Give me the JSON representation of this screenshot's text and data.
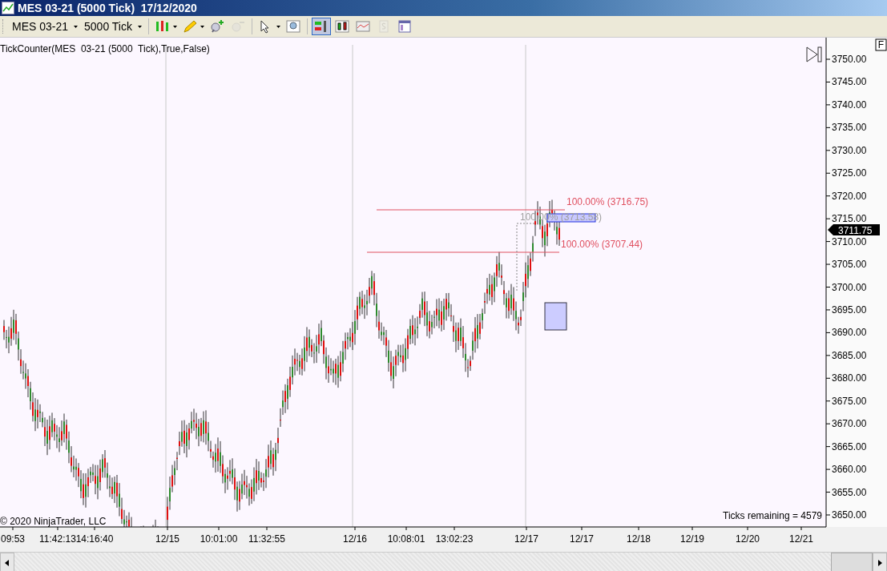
{
  "window": {
    "title": "MES 03-21 (5000 Tick)  17/12/2020"
  },
  "toolbar": {
    "instrument": "MES 03-21",
    "period": "5000 Tick",
    "tools": [
      {
        "kind": "bars",
        "dropdown": true,
        "selected": false,
        "disabled": false
      },
      {
        "kind": "pencil",
        "dropdown": true,
        "selected": false,
        "disabled": false
      },
      {
        "kind": "zoomin",
        "dropdown": false,
        "selected": false,
        "disabled": false
      },
      {
        "kind": "zoomout",
        "dropdown": false,
        "selected": false,
        "disabled": true
      },
      {
        "kind": "pointer",
        "dropdown": true,
        "selected": false,
        "disabled": false
      },
      {
        "kind": "magnifier",
        "dropdown": false,
        "selected": false,
        "disabled": false
      },
      {
        "kind": "databox",
        "dropdown": false,
        "selected": true,
        "disabled": false
      },
      {
        "kind": "candles",
        "dropdown": false,
        "selected": false,
        "disabled": false
      },
      {
        "kind": "lines",
        "dropdown": false,
        "selected": false,
        "disabled": false
      },
      {
        "kind": "dollar",
        "dropdown": false,
        "selected": false,
        "disabled": true
      },
      {
        "kind": "properties",
        "dropdown": false,
        "selected": false,
        "disabled": false
      }
    ]
  },
  "chart": {
    "indicator_label": "TickCounter(MES  03-21 (5000  Tick),True,False)",
    "axis_button": "F",
    "price_labels": [
      "3750.00",
      "3745.00",
      "3740.00",
      "3735.00",
      "3730.00",
      "3725.00",
      "3720.00",
      "3715.00",
      "3710.00",
      "3705.00",
      "3700.00",
      "3695.00",
      "3690.00",
      "3685.00",
      "3680.00",
      "3675.00",
      "3670.00",
      "3665.00",
      "3660.00",
      "3655.00",
      "3650.00"
    ],
    "current_price": "3711.75",
    "levels": [
      {
        "label": "100.00% (3716.75)",
        "kind": "upper"
      },
      {
        "label": "100.00% (3713.58)",
        "kind": "middle"
      },
      {
        "label": "100.00% (3707.44)",
        "kind": "lower"
      }
    ],
    "time_labels": [
      "09:53",
      "11:42:13",
      "14:16:40",
      "12/15",
      "10:01:00",
      "11:32:55",
      "12/16",
      "10:08:01",
      "13:02:23",
      "12/17",
      "12/17",
      "12/18",
      "12/19",
      "12/20",
      "12/21"
    ],
    "copyright": "© 2020 NinjaTrader, LLC",
    "ticks_remaining": "Ticks remaining = 4579"
  }
}
